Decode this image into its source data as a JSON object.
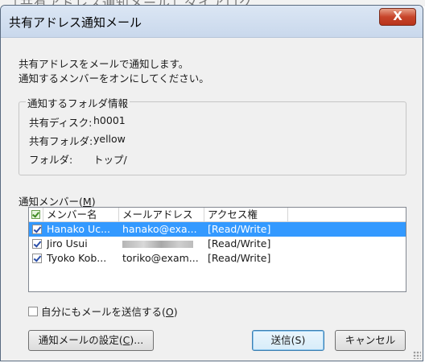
{
  "window": {
    "title": "共有アドレス通知メール",
    "close_label": "X"
  },
  "message": {
    "line1": "共有アドレスをメールで通知します。",
    "line2": "通知するメンバーをオンにしてください。"
  },
  "folder_info": {
    "legend": "通知するフォルダ情報",
    "rows": [
      {
        "label": "共有ディスク:",
        "value": "h0001"
      },
      {
        "label": "共有フォルダ:",
        "value": "yellow"
      },
      {
        "label": "フォルダ:",
        "value": "トップ/"
      }
    ]
  },
  "members": {
    "label_prefix": "通知メンバー(",
    "label_mnemonic": "M",
    "label_suffix": ")",
    "header_icon": "check-all-icon",
    "columns": [
      "メンバー名",
      "メールアドレス",
      "アクセス権"
    ],
    "rows": [
      {
        "name": "Hanako Uc...",
        "email": "hanako@exa...",
        "access": "[Read/Write]",
        "checked": true,
        "selected": true,
        "email_redacted": false
      },
      {
        "name": "Jiro Usui",
        "email": "",
        "access": "[Read/Write]",
        "checked": true,
        "selected": false,
        "email_redacted": true
      },
      {
        "name": "Tyoko Kob...",
        "email": "toriko@exam...",
        "access": "[Read/Write]",
        "checked": true,
        "selected": false,
        "email_redacted": false
      }
    ]
  },
  "self_mail": {
    "label": "自分にもメールを送信する(",
    "mnemonic": "O",
    "suffix": ")",
    "checked": false
  },
  "buttons": {
    "settings_prefix": "通知メールの設定(",
    "settings_mnemonic": "C",
    "settings_suffix": ")...",
    "send": "送信(S)",
    "cancel": "キャンセル"
  },
  "colors": {
    "selection": "#3399ff",
    "close_button": "#c7442a"
  }
}
